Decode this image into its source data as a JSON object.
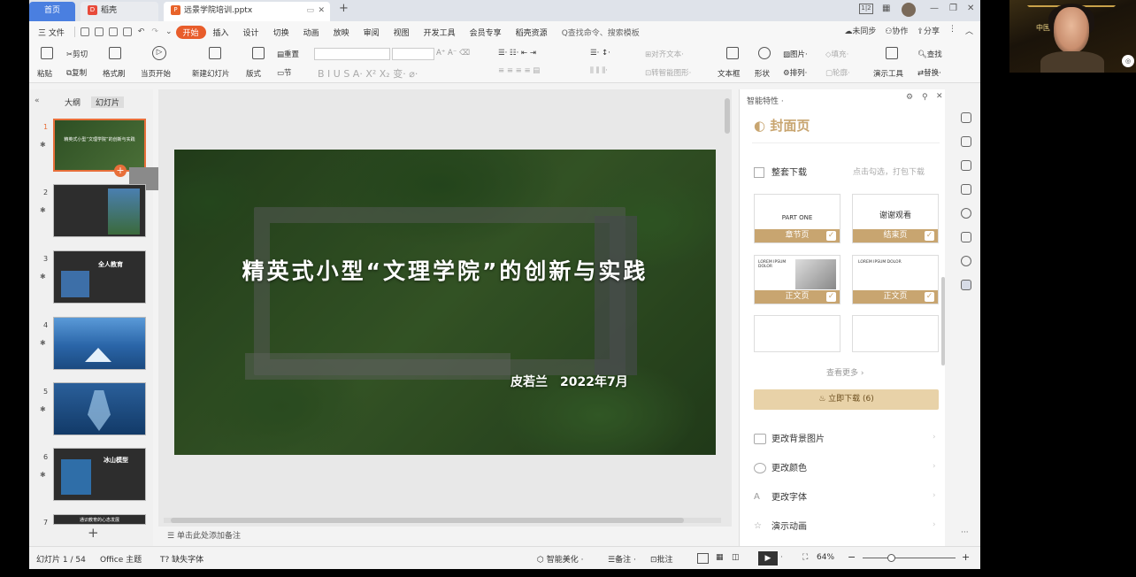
{
  "tabs": {
    "home": "首页",
    "daoke": "稻壳",
    "doc": "远景学院培训.pptx"
  },
  "menu": {
    "file": "三 文件",
    "items": [
      "开始",
      "插入",
      "设计",
      "切换",
      "动画",
      "放映",
      "审阅",
      "视图",
      "开发工具",
      "会员专享",
      "稻壳资源"
    ],
    "search": "Q查找命令、搜索模板",
    "right": [
      "未同步",
      "协作",
      "分享"
    ]
  },
  "ribbon": {
    "paste": "粘贴",
    "cut": "剪切",
    "copy": "复制",
    "format_painter": "格式刷",
    "from_current": "当页开始",
    "new_slide": "新建幻灯片",
    "layout": "版式",
    "section": "节",
    "reset": "重置",
    "align_text": "对齐文本",
    "smart_graphic": "转智能图形",
    "textbox": "文本框",
    "shape": "形状",
    "picture": "图片",
    "arrange": "排列",
    "fill": "填充",
    "outline": "轮廓",
    "find": "查找",
    "replace": "替换",
    "present_tools": "演示工具"
  },
  "left_panel": {
    "outline_tab": "大纲",
    "slides_tab": "幻灯片",
    "thumbs": [
      {
        "num": "1",
        "text": "精英式小型“文理学院”的创新与实践"
      },
      {
        "num": "2",
        "text": ""
      },
      {
        "num": "3",
        "text": "全人教育"
      },
      {
        "num": "4",
        "text": ""
      },
      {
        "num": "5",
        "text": ""
      },
      {
        "num": "6",
        "text": "冰山模型"
      },
      {
        "num": "7",
        "text": "通识教育的心态发展"
      }
    ],
    "add": "+"
  },
  "slide": {
    "title": "精英式小型“文理学院”的创新与实践",
    "subtitle": "皮若兰　2022年7月"
  },
  "notes_placeholder": "单击此处添加备注",
  "right_panel": {
    "header": "智能特性",
    "cover_title": "封面页",
    "download_all": "整套下载",
    "download_hint": "点击勾选，打包下载",
    "templates": [
      {
        "label": "章节页",
        "text": "PART ONE"
      },
      {
        "label": "结束页",
        "text": "谢谢观看"
      },
      {
        "label": "正文页",
        "text": "LOREM IPSUM DOLOR"
      },
      {
        "label": "正文页",
        "text": "LOREM IPSUM DOLOR"
      }
    ],
    "see_more": "查看更多",
    "download_now": "立即下载 (6)",
    "options": [
      "更改背景图片",
      "更改颜色",
      "更改字体",
      "演示动画"
    ]
  },
  "status": {
    "slide_count": "幻灯片 1 / 54",
    "theme": "Office 主题",
    "missing_font": "缺失字体",
    "beautify": "智能美化",
    "notes": "备注",
    "comments": "批注",
    "zoom": "64%"
  },
  "webcam": {
    "banner": "中国 团"
  }
}
